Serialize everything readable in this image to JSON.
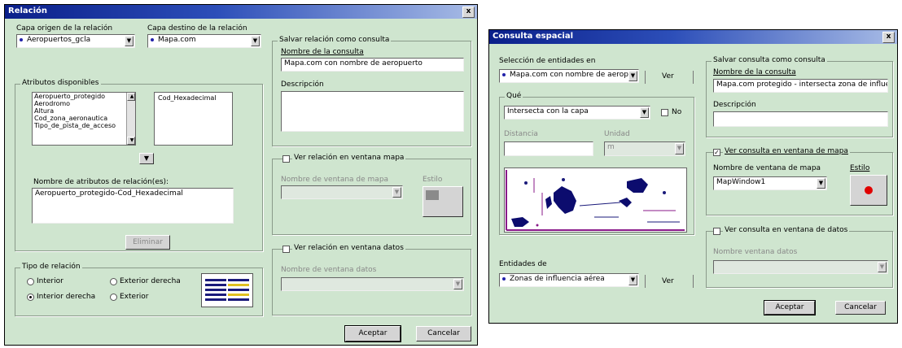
{
  "left": {
    "title": "Relación",
    "close": "x",
    "layer_label": "Capa origen de la relación",
    "layer_value": "Aeropuertos_gcla",
    "dest_label": "Capa destino de la relación",
    "dest_value": "Mapa.com",
    "attrs_group": "Atributos disponibles",
    "attrs_list": [
      "Aeropuerto_protegido",
      "Aerodromo",
      "Altura",
      "Cod_zona_aeronautica",
      "Tipo_de_pista_de_acceso"
    ],
    "attrs_selected": "Cod_Hexadecimal",
    "relation_attr_label": "Nombre de atributos de relación(es):",
    "relation_attr_value": "Aeropuerto_protegido-Cod_Hexadecimal",
    "delete_btn": "Eliminar",
    "type_group": "Tipo de relación",
    "rad_inner": "Interior",
    "rad_right_outer": "Exterior derecha",
    "rad_left_outer": "Interior derecha",
    "rad_outer": "Exterior",
    "save_group": "Salvar relación como consulta",
    "query_name_label": "Nombre de la consulta",
    "query_name_value": "Mapa.com con nombre de aeropuerto",
    "desc_label": "Descripción",
    "map_chk": "Ver relación en ventana mapa",
    "map_win_label": "Nombre de ventana de mapa",
    "style_label": "Estilo",
    "data_chk": "Ver relación en ventana datos",
    "data_win_label": "Nombre de ventana datos",
    "accept": "Aceptar",
    "cancel": "Cancelar"
  },
  "right": {
    "title": "Consulta espacial",
    "close": "x",
    "sel_label": "Selección de entidades en",
    "sel_value": "Mapa.com con nombre de aeropuerto",
    "sel_btn": "Ver",
    "what_group": "Qué",
    "what_value": "Intersecta con la capa",
    "what_chk": "No",
    "dist_label": "Distancia",
    "unit_label": "Unidad",
    "unit_value": "m",
    "entities_label": "Entidades de",
    "entities_value": "Zonas de influencia aérea",
    "entities_btn": "Ver",
    "save_group": "Salvar consulta como consulta",
    "query_name_label": "Nombre de la consulta",
    "query_name_value": "Mapa.com protegido - intersecta zona de influencia aérea",
    "desc_label": "Descripción",
    "map_chk": "Ver consulta en ventana de mapa",
    "map_win_label": "Nombre de ventana de mapa",
    "map_win_value": "MapWindow1",
    "style_label": "Estilo",
    "data_chk": "Ver consulta en ventana de datos",
    "data_win_label": "Nombre ventana datos",
    "accept": "Aceptar",
    "cancel": "Cancelar"
  },
  "colors": {
    "dialog_bg": "#cfe5cf",
    "title_start": "#0a1f8a",
    "title_end": "#a8bce6",
    "style_dot": "#e00000"
  }
}
